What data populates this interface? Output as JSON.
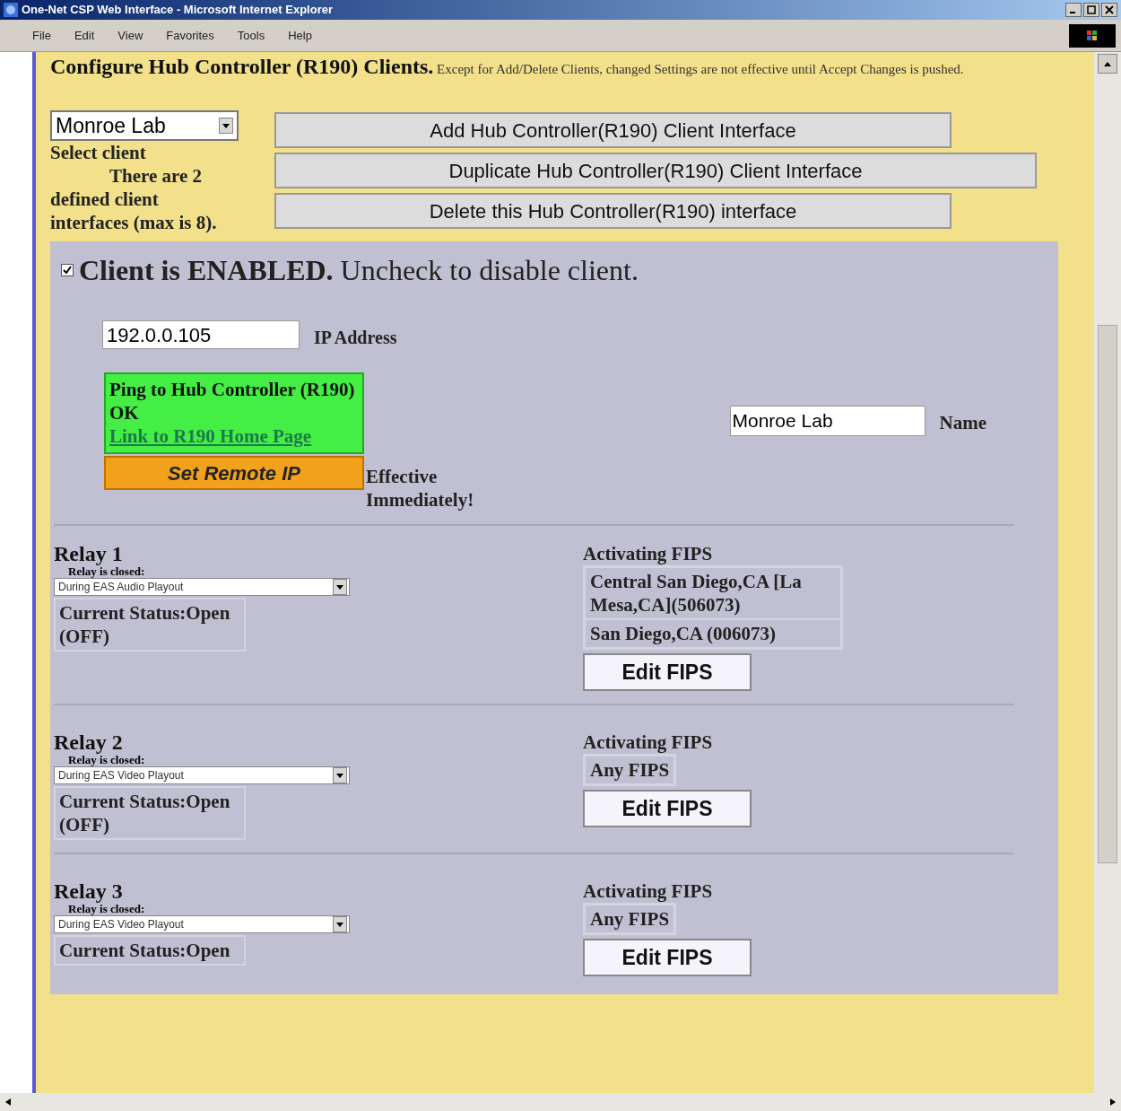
{
  "window": {
    "title": "One-Net CSP Web Interface - Microsoft Internet Explorer"
  },
  "menu": [
    "File",
    "Edit",
    "View",
    "Favorites",
    "Tools",
    "Help"
  ],
  "header": {
    "title": "Configure Hub Controller (R190) Clients.",
    "note": "Except for Add/Delete Clients, changed Settings are not effective until Accept Changes is pushed."
  },
  "client_select": {
    "value": "Monroe Lab",
    "label": "Select client",
    "info": "There are 2 defined client interfaces (max is 8)."
  },
  "actions": [
    "Add Hub Controller(R190) Client Interface",
    "Duplicate Hub Controller(R190) Client Interface",
    "Delete this Hub Controller(R190) interface"
  ],
  "enabled": {
    "checked": true,
    "text": "**Client is ENABLED.** Uncheck to disable client."
  },
  "ip": {
    "value": "192.0.0.105",
    "label": "IP Address"
  },
  "ping": {
    "status": "Ping to Hub Controller (R190) OK",
    "link": "Link to R190 Home Page"
  },
  "set_ip": {
    "button": "Set Remote IP",
    "note": "Effective Immediately!"
  },
  "name": {
    "value": "Monroe Lab",
    "label": "Name"
  },
  "relays": [
    {
      "title": "Relay 1",
      "closed_label": "Relay is closed:",
      "mode": "During EAS Audio Playout",
      "status": "Current Status:Open (OFF)",
      "fips_label": "Activating FIPS",
      "fips": [
        "Central San Diego,CA [La Mesa,CA](506073)",
        "San Diego,CA (006073)"
      ],
      "edit": "Edit FIPS"
    },
    {
      "title": "Relay 2",
      "closed_label": "Relay is closed:",
      "mode": "During EAS Video Playout",
      "status": "Current Status:Open (OFF)",
      "fips_label": "Activating FIPS",
      "fips": [
        "Any FIPS"
      ],
      "edit": "Edit FIPS"
    },
    {
      "title": "Relay 3",
      "closed_label": "Relay is closed:",
      "mode": "During EAS Video Playout",
      "status": "Current Status:Open",
      "fips_label": "Activating FIPS",
      "fips": [
        "Any FIPS"
      ],
      "edit": "Edit FIPS"
    }
  ]
}
